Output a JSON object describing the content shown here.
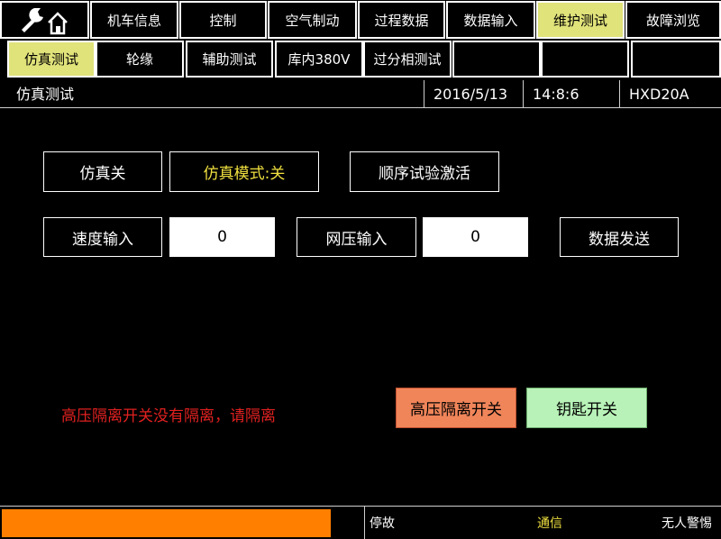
{
  "top_tabs": [
    {
      "label": "机车信息",
      "active": false
    },
    {
      "label": "控制",
      "active": false
    },
    {
      "label": "空气制动",
      "active": false
    },
    {
      "label": "过程数据",
      "active": false
    },
    {
      "label": "数据输入",
      "active": false
    },
    {
      "label": "维护测试",
      "active": true
    },
    {
      "label": "故障浏览",
      "active": false
    }
  ],
  "sub_tabs": [
    {
      "label": "仿真测试",
      "active": true
    },
    {
      "label": "轮缘",
      "active": false
    },
    {
      "label": "辅助测试",
      "active": false
    },
    {
      "label": "库内380V",
      "active": false
    },
    {
      "label": "过分相测试",
      "active": false
    },
    {
      "label": "",
      "active": false
    },
    {
      "label": "",
      "active": false
    }
  ],
  "header": {
    "title": "仿真测试",
    "date": "2016/5/13",
    "time": "14:8:6",
    "model": "HXD20A"
  },
  "controls": {
    "sim_off": "仿真关",
    "sim_mode": "仿真模式:关",
    "sequence_test": "顺序试验激活",
    "speed_label": "速度输入",
    "speed_value": "0",
    "voltage_label": "网压输入",
    "voltage_value": "0",
    "send_data": "数据发送"
  },
  "warning": "高压隔离开关没有隔离，请隔离",
  "switches": {
    "hv_isolation": "高压隔离开关",
    "key_switch": "钥匙开关"
  },
  "status_bar": {
    "status1": "停故",
    "status2": "通信",
    "status3": "无人警惕"
  },
  "colors": {
    "active_tab": "#e0e27a",
    "warning_text": "#e02020",
    "highlight_text": "#f0e040",
    "hv_button": "#f0855a",
    "key_button": "#b8f2b8",
    "status_orange": "#ff8000"
  },
  "icons": {
    "home": "wrench-house-icon"
  }
}
